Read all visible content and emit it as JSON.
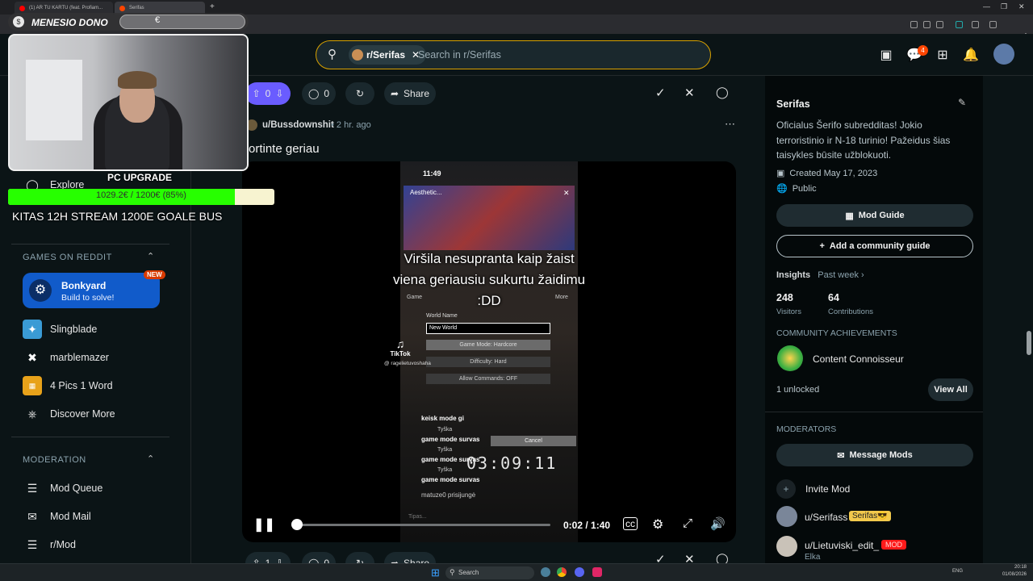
{
  "browser": {
    "tabs": [
      {
        "label": "(1) AR TU KARTU (feat. Profiam..."
      },
      {
        "label": "Serifas"
      }
    ]
  },
  "stream_overlay": {
    "donation_label": "MENESIO DONO",
    "donation_value": "€",
    "goal_title": "PC UPGRADE",
    "goal_progress_text": "1029.2€ / 1200€ (85%)",
    "goal_progress": 0.85,
    "banner": "KITAS 12H STREAM 1200E GOALE BUS"
  },
  "header": {
    "community_chip": "r/Serifas",
    "search_placeholder": "Search in r/Serifas",
    "notification_count": "4"
  },
  "sidebar": {
    "explore": "Explore",
    "games_section": "GAMES ON REDDIT",
    "featured_game": {
      "title": "Bonkyard",
      "subtitle": "Build to solve!",
      "badge": "NEW"
    },
    "games": [
      {
        "label": "Slingblade"
      },
      {
        "label": "marblemazer"
      },
      {
        "label": "4 Pics 1 Word"
      },
      {
        "label": "Discover More"
      }
    ],
    "moderation_section": "MODERATION",
    "moderation": [
      {
        "label": "Mod Queue"
      },
      {
        "label": "Mod Mail"
      },
      {
        "label": "r/Mod"
      }
    ]
  },
  "prev_post_bar": {
    "votes": "0",
    "comments": "0",
    "share": "Share"
  },
  "post": {
    "author": "u/Bussdownshit",
    "time": "2 hr. ago",
    "title": "ortinte geriau",
    "video": {
      "phone_time": "11:49",
      "caption": "Viršila nesupranta kaip žaist viena geriausiu sukurtu žaidimu :DD",
      "tiktok_label": "TikTok",
      "tiktok_handle": "@ ragelietuvoshaha",
      "streamer_name": "Aesthetic...",
      "form_title": "World Name",
      "form_value": "New World",
      "options": [
        "Game Mode: Hardcore",
        "Difficulty: Hard",
        "Allow Commands: OFF"
      ],
      "cancel_label": "Cancel",
      "tabs": [
        "Game",
        "More"
      ],
      "chat": [
        {
          "name": "",
          "text": "keisk mode gi"
        },
        {
          "name": "Tyška",
          "text": "game mode survas"
        },
        {
          "name": "Tyška",
          "text": "game mode survas"
        },
        {
          "name": "Tyška",
          "text": "game mode survas"
        },
        {
          "name": "matuze0",
          "text": "prisijungė"
        }
      ],
      "comment_placeholder": "Tipas...",
      "stream_timer": "03:09:11",
      "time_display": "0:02 / 1:40",
      "played_fraction": 0.02
    }
  },
  "next_post_bar": {
    "votes": "1",
    "comments": "0",
    "share": "Share"
  },
  "community": {
    "name": "Serifas",
    "description": "Oficialus Šerifo subredditas! Jokio terroristinio ir N-18 turinio! Pažeidus šias taisykles būsite užblokuoti.",
    "created": "Created May 17, 2023",
    "visibility": "Public",
    "mod_guide": "Mod Guide",
    "add_guide": "Add a community guide",
    "insights": "Insights",
    "insights_period": "Past week",
    "visitors": "248",
    "visitors_label": "Visitors",
    "contributions": "64",
    "contributions_label": "Contributions",
    "achievements_title": "COMMUNITY ACHIEVEMENTS",
    "achievement": "Content Connoisseur",
    "unlocked": "1 unlocked",
    "view_all": "View All",
    "moderators_title": "MODERATORS",
    "message_mods": "Message Mods",
    "invite_mod": "Invite Mod",
    "mods": [
      {
        "name": "u/Serifass",
        "flair": "Serifas😎"
      },
      {
        "name": "u/Lietuviski_edit_",
        "flair": "MOD",
        "sub": "Elka"
      }
    ]
  },
  "taskbar": {
    "search": "Search",
    "lang": "ENG",
    "time": "20:18",
    "date": "01/08/2026"
  },
  "colors": {
    "bg": "#0b1416",
    "accent_blue": "#115bca",
    "goal_green": "#27ff00",
    "search_border": "#d8a100"
  }
}
